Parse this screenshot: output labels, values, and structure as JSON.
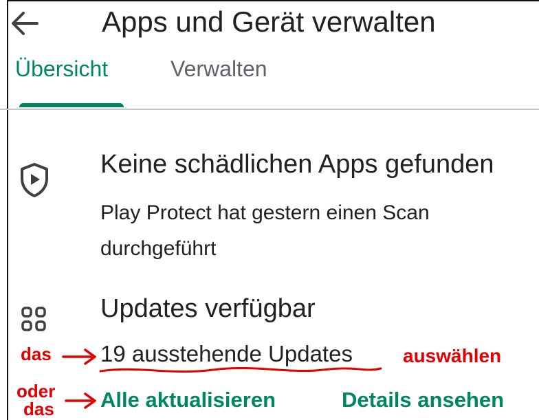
{
  "header": {
    "title": "Apps und Gerät verwalten",
    "back_icon": "arrow-back-icon"
  },
  "tabs": [
    {
      "label": "Übersicht",
      "active": true
    },
    {
      "label": "Verwalten",
      "active": false
    }
  ],
  "protect": {
    "icon": "shield-play-icon",
    "title": "Keine schädlichen Apps gefunden",
    "subtitle": "Play Protect hat gestern einen Scan durchgeführt"
  },
  "updates": {
    "icon": "apps-grid-icon",
    "title": "Updates verfügbar",
    "pending": "19 ausstehende Updates",
    "update_all_label": "Alle aktualisieren",
    "details_label": "Details ansehen"
  },
  "annotations": {
    "das": "das",
    "oder": "oder",
    "das2": "das",
    "auswaehlen": "auswählen",
    "color": "#e30000"
  },
  "colors": {
    "accent": "#01875f",
    "text": "#202124",
    "secondary": "#5f6368"
  }
}
